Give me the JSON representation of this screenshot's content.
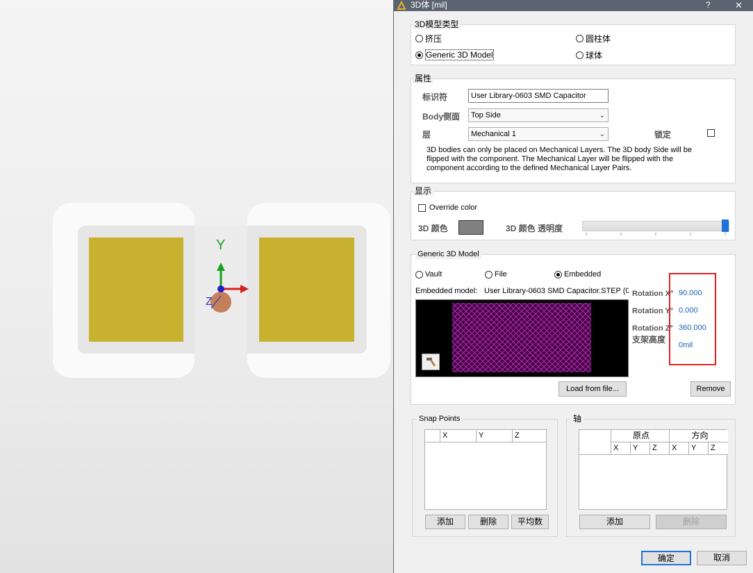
{
  "dialog": {
    "title": "3D体 [mil]",
    "help": "?",
    "close": "✕"
  },
  "viewport": {
    "axis_y_label": "Y",
    "axis_z_label": "Z",
    "pad_color": "#c8b12e"
  },
  "model_type": {
    "legend": "3D模型类型",
    "options": [
      {
        "label": "挤压",
        "selected": false
      },
      {
        "label": "圆柱体",
        "selected": false
      },
      {
        "label": "Generic 3D Model",
        "selected": true
      },
      {
        "label": "球体",
        "selected": false
      }
    ]
  },
  "properties": {
    "legend": "属性",
    "identifier_label": "标识符",
    "identifier_value": "User Library-0603 SMD Capacitor",
    "body_side_label": "Body侧面",
    "body_side_value": "Top Side",
    "layer_label": "层",
    "layer_value": "Mechanical 1",
    "lock_label": "锁定",
    "note": "3D bodies can only be placed on Mechanical Layers. The 3D body Side will be flipped with the component. The Mechanical Layer will be flipped with the component according to the defined Mechanical Layer Pairs."
  },
  "display": {
    "legend": "显示",
    "override_label": "Override color",
    "color_label": "3D 颜色",
    "color_value": "#808080",
    "opacity_label": "3D 颜色 透明度"
  },
  "generic": {
    "legend": "Generic 3D Model",
    "source_options": [
      {
        "label": "Vault",
        "selected": false
      },
      {
        "label": "File",
        "selected": false
      },
      {
        "label": "Embedded",
        "selected": true
      }
    ],
    "embedded_label": "Embedded model:",
    "embedded_value": "User Library-0603 SMD Capacitor.STEP (0",
    "rot_x_label": "Rotation X°",
    "rot_x_value": "90.000",
    "rot_y_label": "Rotation Y°",
    "rot_y_value": "0.000",
    "rot_z_label": "Rotation Z°",
    "rot_z_value": "360.000",
    "standoff_label": "支架高度",
    "standoff_value": "0mil",
    "load_button": "Load from file...",
    "remove_button": "Remove",
    "highlight_color": "#e02020"
  },
  "snap_points": {
    "legend": "Snap Points",
    "columns": [
      "X",
      "Y",
      "Z"
    ],
    "add_button": "添加",
    "delete_button": "删除",
    "average_button": "平均数"
  },
  "axis": {
    "legend": "轴",
    "group_origin": "原点",
    "group_direction": "方向",
    "columns": [
      "X",
      "Y",
      "Z",
      "X",
      "Y",
      "Z"
    ],
    "add_button": "添加",
    "delete_button": "删除"
  },
  "footer": {
    "ok_button": "确定",
    "cancel_button": "取消"
  }
}
